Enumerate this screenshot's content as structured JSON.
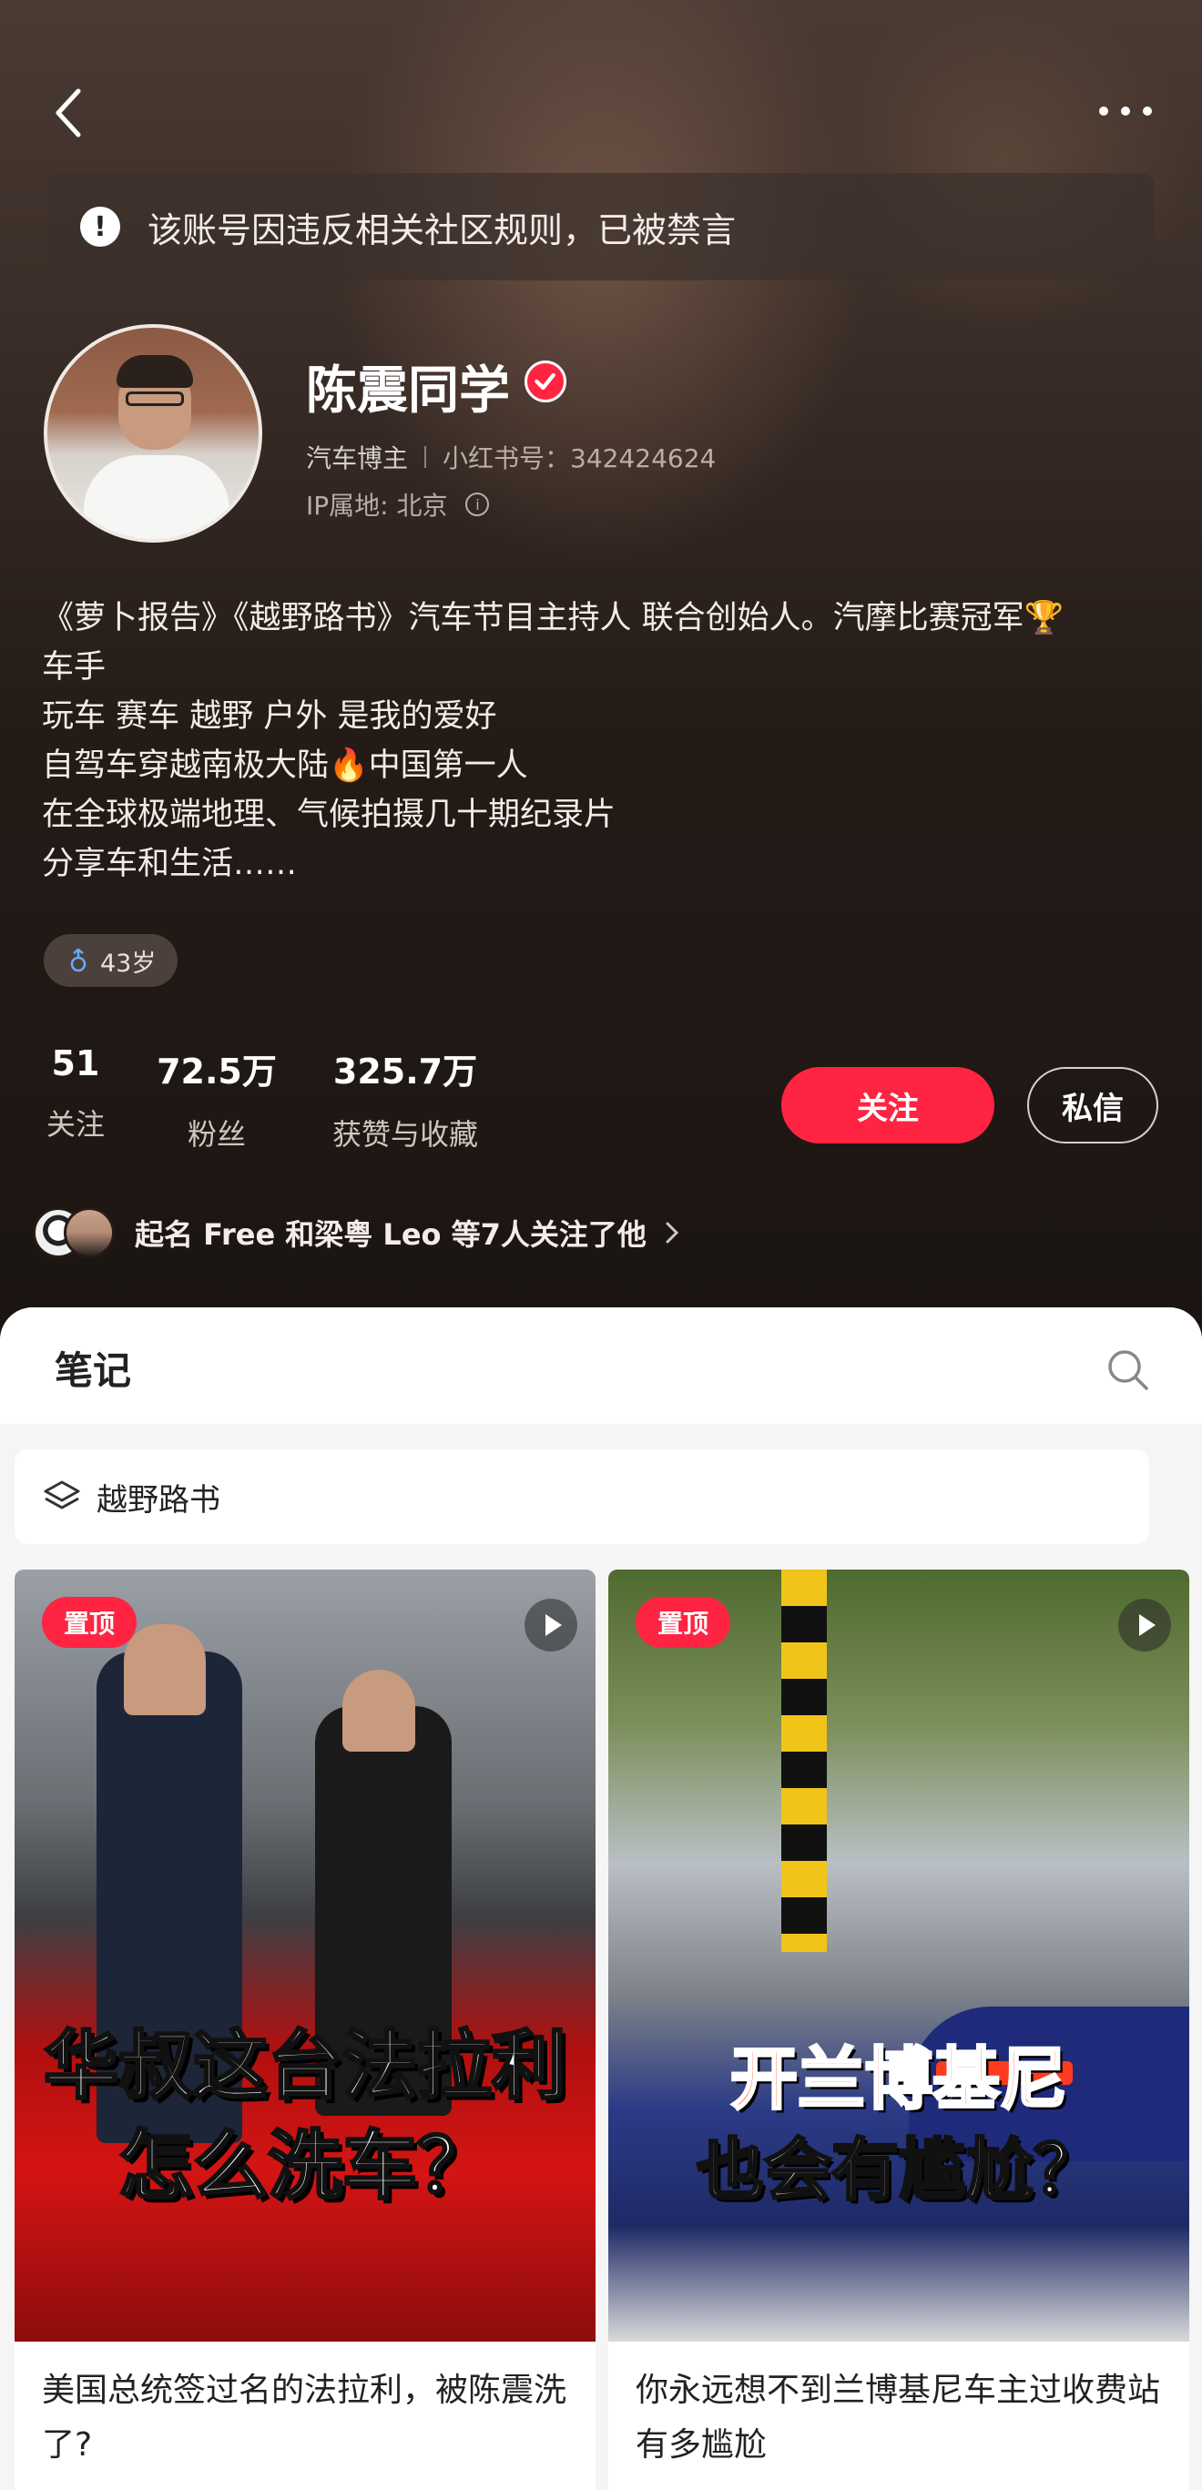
{
  "header": {
    "ban_notice": "该账号因违反相关社区规则，已被禁言",
    "ban_icon_glyph": "!"
  },
  "profile": {
    "name": "陈震同学",
    "role": "汽车博主",
    "id_text": "小红书号：342424624",
    "ip_location": "IP属地: 北京",
    "info_glyph": "i",
    "bio_lines": [
      "《萝卜报告》《越野路书》汽车节目主持人 联合创始人。汽摩比赛冠军🏆",
      "车手",
      "玩车 赛车 越野 户外 是我的爱好",
      "自驾车穿越南极大陆🔥中国第一人",
      "在全球极端地理、气候拍摄几十期纪录片",
      "分享车和生活……"
    ],
    "age_tag": "43岁"
  },
  "stats": [
    {
      "value": "51",
      "label": "关注"
    },
    {
      "value": "72.5万",
      "label": "粉丝"
    },
    {
      "value": "325.7万",
      "label": "获赞与收藏"
    }
  ],
  "actions": {
    "follow": "关注",
    "message": "私信"
  },
  "mutual": {
    "text": "起名 Free 和梁粤 Leo 等7人关注了他"
  },
  "notes": {
    "tab_label": "笔记",
    "collection_label": "越野路书",
    "cards": [
      {
        "badge": "置顶",
        "cover_line1": "华叔这台法拉利",
        "cover_line2": "怎么洗车？",
        "title": "美国总统签过名的法拉利，被陈震洗了?"
      },
      {
        "badge": "置顶",
        "cover_line1": "开兰博基尼",
        "cover_line2": "也会有尴尬？",
        "title": "你永远想不到兰博基尼车主过收费站有多尴尬"
      }
    ]
  },
  "colors": {
    "accent": "#ff2442",
    "header_bg": "#241b17",
    "sheet_bg": "#f5f5f5"
  },
  "icons": [
    "back-icon",
    "more-icon",
    "alert-icon",
    "verified-icon",
    "info-icon",
    "male-icon",
    "chevron-right-icon",
    "search-icon",
    "layers-icon",
    "play-icon"
  ]
}
